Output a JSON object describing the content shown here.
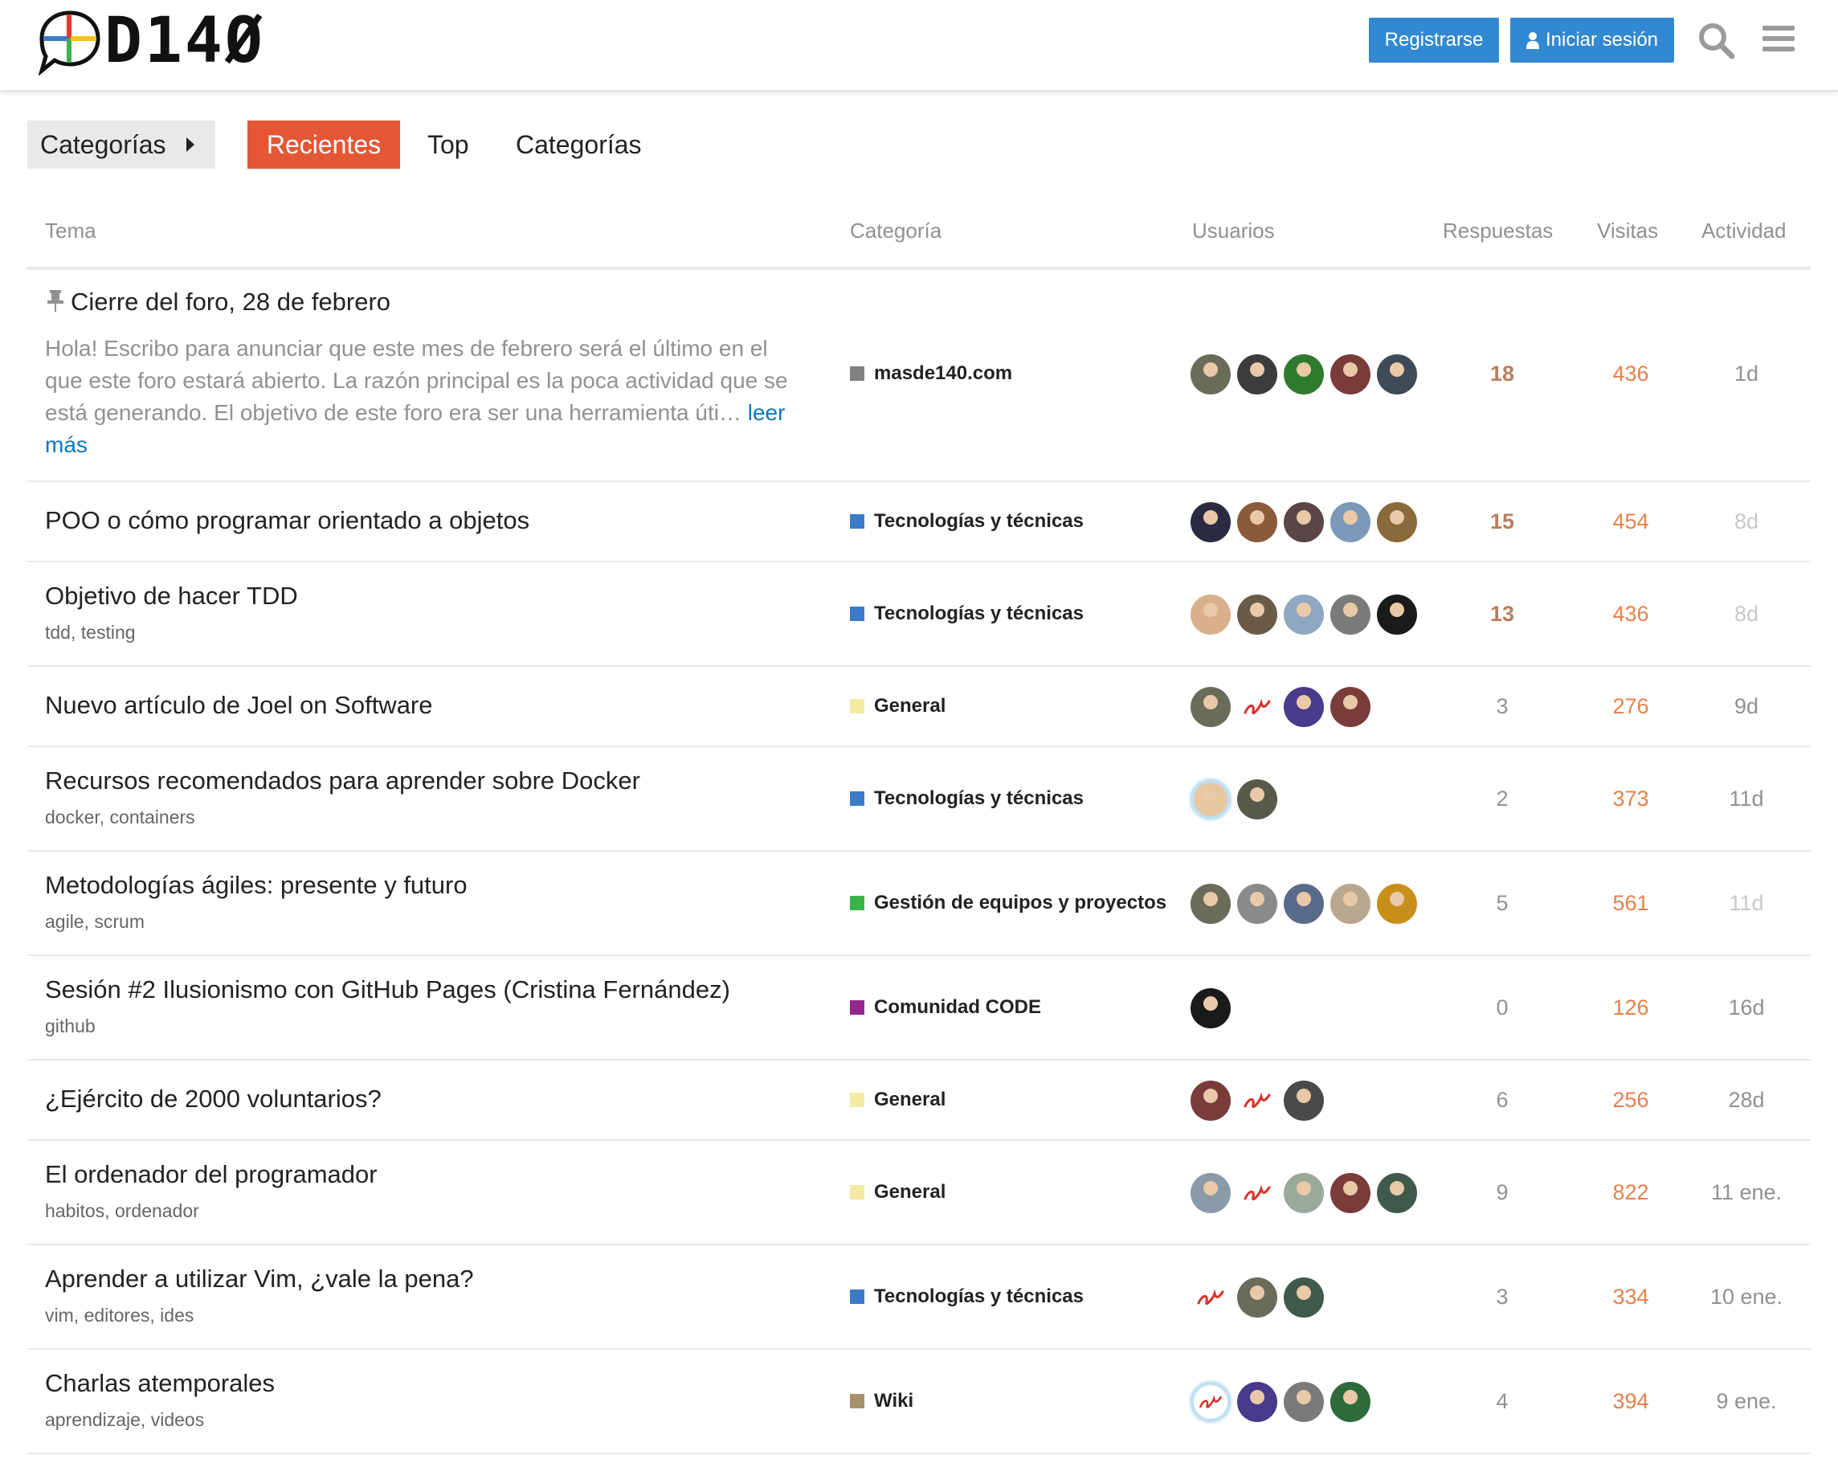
{
  "header": {
    "logo_text": "D14Ø",
    "register_label": "Registrarse",
    "login_label": "Iniciar sesión"
  },
  "nav": {
    "categories_dropdown": "Categorías",
    "tabs": [
      {
        "label": "Recientes",
        "active": true
      },
      {
        "label": "Top",
        "active": false
      },
      {
        "label": "Categorías",
        "active": false
      }
    ]
  },
  "table": {
    "headers": {
      "topic": "Tema",
      "category": "Categoría",
      "users": "Usuarios",
      "replies": "Respuestas",
      "views": "Visitas",
      "activity": "Actividad"
    },
    "rows": [
      {
        "title": "Cierre del foro, 28 de febrero",
        "pinned": true,
        "excerpt": "Hola! Escribo para anunciar que este mes de febrero será el último en el que este foro estará abierto. La razón principal es la poca actividad que se está generando. El objetivo de este foro era ser una herramienta úti…",
        "read_more": "leer más",
        "tags": [],
        "category": "masde140.com",
        "category_color": "#808281",
        "avatars": [
          "#6b6b5a",
          "#3c3c3c",
          "#2f7a2f",
          "#7a3b3b",
          "#3f4a57"
        ],
        "replies": "18",
        "views": "436",
        "activity": "1d"
      },
      {
        "title": "POO o cómo programar orientado a objetos",
        "tags": [],
        "category": "Tecnologías y técnicas",
        "category_color": "#3b7bc8",
        "avatars": [
          "#2a2a40",
          "#8a5a3a",
          "#5a4646",
          "#7d98b8",
          "#8a6a3a"
        ],
        "replies": "15",
        "views": "454",
        "activity": "8d"
      },
      {
        "title": "Objetivo de hacer TDD",
        "tags": [
          "tdd",
          "testing"
        ],
        "category": "Tecnologías y técnicas",
        "category_color": "#3b7bc8",
        "avatars": [
          "#d8b08c",
          "#6a5a4a",
          "#8fa8c2",
          "#7a7a7a",
          "#1a1a1a"
        ],
        "replies": "13",
        "views": "436",
        "activity": "8d"
      },
      {
        "title": "Nuevo artículo de Joel on Software",
        "tags": [],
        "category": "General",
        "category_color": "#f1eba4",
        "avatars": [
          "#6b6b5a",
          "#e04848",
          "#4a3a8a",
          "#7a3b3b"
        ],
        "replies": "3",
        "views": "276",
        "activity": "9d"
      },
      {
        "title": "Recursos recomendados para aprender sobre Docker",
        "tags": [
          "docker",
          "containers"
        ],
        "category": "Tecnologías y técnicas",
        "category_color": "#3b7bc8",
        "avatars": [
          "#e8c8a0",
          "#5a5a4a"
        ],
        "replies": "2",
        "views": "373",
        "activity": "11d"
      },
      {
        "title": "Metodologías ágiles: presente y futuro",
        "tags": [
          "agile",
          "scrum"
        ],
        "category": "Gestión de equipos y proyectos",
        "category_color": "#3ab44a",
        "avatars": [
          "#6b6b5a",
          "#8a8a8a",
          "#5a6a8a",
          "#b8a890",
          "#c8901a"
        ],
        "replies": "5",
        "views": "561",
        "activity": "11d"
      },
      {
        "title": "Sesión #2 Ilusionismo con GitHub Pages (Cristina Fernández)",
        "tags": [
          "github"
        ],
        "category": "Comunidad CODE",
        "category_color": "#92278f",
        "avatars": [
          "#1a1a1a"
        ],
        "replies": "0",
        "views": "126",
        "activity": "16d"
      },
      {
        "title": "¿Ejército de 2000 voluntarios?",
        "tags": [],
        "category": "General",
        "category_color": "#f1eba4",
        "avatars": [
          "#7a3b3b",
          "#e04848",
          "#4a4a4a"
        ],
        "replies": "6",
        "views": "256",
        "activity": "28d"
      },
      {
        "title": "El ordenador del programador",
        "tags": [
          "habitos",
          "ordenador"
        ],
        "category": "General",
        "category_color": "#f1eba4",
        "avatars": [
          "#8a9aa8",
          "#e04848",
          "#9aaa9a",
          "#7a3b3b",
          "#3f5a4a"
        ],
        "replies": "9",
        "views": "822",
        "activity": "11 ene."
      },
      {
        "title": "Aprender a utilizar Vim, ¿vale la pena?",
        "tags": [
          "vim",
          "editores",
          "ides"
        ],
        "category": "Tecnologías y técnicas",
        "category_color": "#3b7bc8",
        "avatars": [
          "#e04848",
          "#6b6b5a",
          "#3f5a4a"
        ],
        "replies": "3",
        "views": "334",
        "activity": "10 ene."
      },
      {
        "title": "Charlas atemporales",
        "tags": [
          "aprendizaje",
          "videos"
        ],
        "category": "Wiki",
        "category_color": "#a8906a",
        "avatars": [
          "#e04848",
          "#4a3a8a",
          "#7a7a7a",
          "#2f6a3a"
        ],
        "replies": "4",
        "views": "394",
        "activity": "9 ene."
      }
    ]
  }
}
